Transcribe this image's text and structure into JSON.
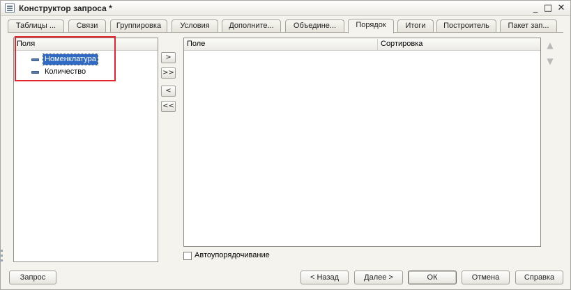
{
  "window": {
    "title": "Конструктор запроса *"
  },
  "title_controls": {
    "minimize": "_",
    "maximize": "□",
    "close": "✕"
  },
  "tabs": [
    {
      "label": "Таблицы ..."
    },
    {
      "label": "Связи"
    },
    {
      "label": "Группировка"
    },
    {
      "label": "Условия"
    },
    {
      "label": "Дополните..."
    },
    {
      "label": "Объедине..."
    },
    {
      "label": "Порядок",
      "active": true
    },
    {
      "label": "Итоги"
    },
    {
      "label": "Построитель"
    },
    {
      "label": "Пакет зап..."
    }
  ],
  "fields_panel": {
    "header": "Поля",
    "items": [
      {
        "label": "Номенклатура",
        "selected": true
      },
      {
        "label": "Количество",
        "selected": false
      }
    ]
  },
  "transfer_buttons": {
    "add": ">",
    "add_all": ">>",
    "remove": "<",
    "remove_all": "<<"
  },
  "order_table": {
    "columns": [
      "Поле",
      "Сортировка"
    ],
    "rows": []
  },
  "move_buttons": {
    "up": "▲",
    "down": "▼"
  },
  "auto_order": {
    "label": "Автоупорядочивание",
    "checked": false
  },
  "bottom_buttons": {
    "query": "Запрос",
    "back": "< Назад",
    "next": "Далее >",
    "ok": "ОК",
    "cancel": "Отмена",
    "help": "Справка"
  },
  "colors": {
    "selection": "#316ac5",
    "highlight_frame": "#e2262c"
  }
}
